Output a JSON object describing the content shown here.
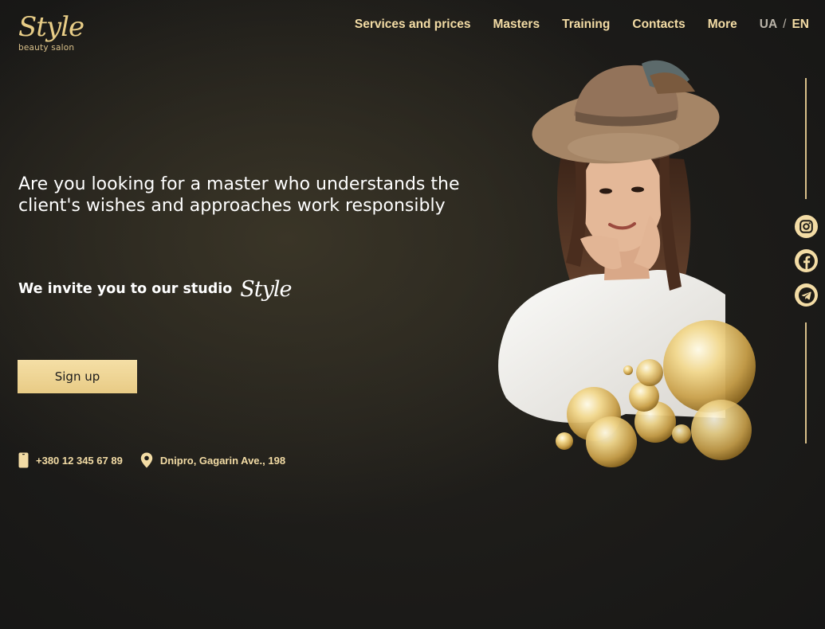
{
  "brand": {
    "logo_script": "Style",
    "logo_sub": "beauty salon",
    "accent": "#f3dca5",
    "accent_dark": "#e8cb85"
  },
  "nav": {
    "items": [
      {
        "label": "Services and prices"
      },
      {
        "label": "Masters"
      },
      {
        "label": "Training"
      },
      {
        "label": "Contacts"
      },
      {
        "label": "More"
      }
    ],
    "lang": {
      "ua": "UA",
      "sep": "/",
      "en": "EN"
    }
  },
  "hero": {
    "headline": "Are you looking for a master who understands the client's wishes and approaches work responsibly",
    "invite": "We invite you to our studio",
    "invite_logo": "Style",
    "signup_label": "Sign up"
  },
  "contacts": {
    "phone": "+380 12 345 67 89",
    "address": "Dnipro, Gagarin Ave., 198",
    "phone_icon": "phone-icon",
    "address_icon": "location-pin-icon"
  },
  "social": {
    "items": [
      {
        "icon": "instagram-icon"
      },
      {
        "icon": "facebook-icon"
      },
      {
        "icon": "telegram-icon"
      }
    ]
  }
}
